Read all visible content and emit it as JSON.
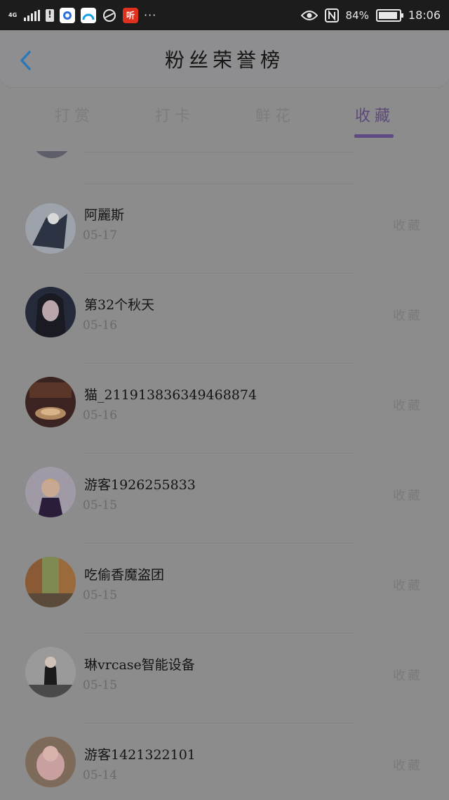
{
  "status_bar": {
    "network": "4G",
    "app_icon_ting": "听",
    "more": "···",
    "battery": "84%",
    "time": "18:06"
  },
  "header": {
    "title": "粉丝荣誉榜"
  },
  "tabs": [
    {
      "label": "打赏",
      "active": false
    },
    {
      "label": "打卡",
      "active": false
    },
    {
      "label": "鲜花",
      "active": false
    },
    {
      "label": "收藏",
      "active": true
    }
  ],
  "list": [
    {
      "name": "阿麗斯",
      "date": "05-17",
      "action": "收藏"
    },
    {
      "name": "第32个秋天",
      "date": "05-16",
      "action": "收藏"
    },
    {
      "name": "猫_211913836349468874",
      "date": "05-16",
      "action": "收藏"
    },
    {
      "name": "游客1926255833",
      "date": "05-15",
      "action": "收藏"
    },
    {
      "name": "吃偷香魔盗团",
      "date": "05-15",
      "action": "收藏"
    },
    {
      "name": "琳vrcase智能设备",
      "date": "05-15",
      "action": "收藏"
    },
    {
      "name": "游客1421322101",
      "date": "05-14",
      "action": "收藏"
    }
  ],
  "colors": {
    "accent": "#5e4b84",
    "back_arrow": "#2a78b8"
  }
}
